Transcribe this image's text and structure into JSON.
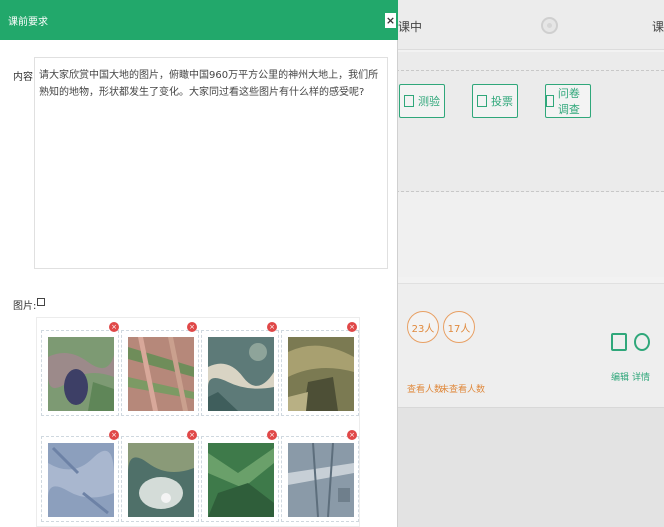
{
  "background": {
    "status_text": "课中",
    "right_text": "课",
    "buttons": [
      {
        "label": "测验",
        "icon": "quiz-icon"
      },
      {
        "label": "投票",
        "icon": "vote-icon"
      },
      {
        "label": "问卷调查",
        "icon": "survey-icon"
      }
    ],
    "stats": [
      {
        "value": "23人",
        "label": "查看人数"
      },
      {
        "value": "17人",
        "label": "未查看人数"
      }
    ],
    "actions": [
      {
        "label": "编辑",
        "icon": "edit-icon"
      },
      {
        "label": "详情",
        "icon": "eye-icon"
      }
    ]
  },
  "modal": {
    "title": "课前要求",
    "close_label": "×",
    "content_label": "内容:",
    "content_text": "请大家欣赏中国大地的图片，俯瞰中国960万平方公里的神州大地上，我们所熟知的地物，形状都发生了变化。大家同过看这些图片有什么样的感受呢?",
    "images_label": "图片:",
    "delete_label": "×",
    "images": [
      {
        "name": "satellite-image-1"
      },
      {
        "name": "satellite-image-2"
      },
      {
        "name": "satellite-image-3"
      },
      {
        "name": "satellite-image-4"
      },
      {
        "name": "satellite-image-5"
      },
      {
        "name": "satellite-image-6"
      },
      {
        "name": "satellite-image-7"
      },
      {
        "name": "satellite-image-8"
      }
    ]
  },
  "colors": {
    "accent": "#22a86b",
    "stat": "#e08a3e",
    "delete": "#e04848"
  }
}
